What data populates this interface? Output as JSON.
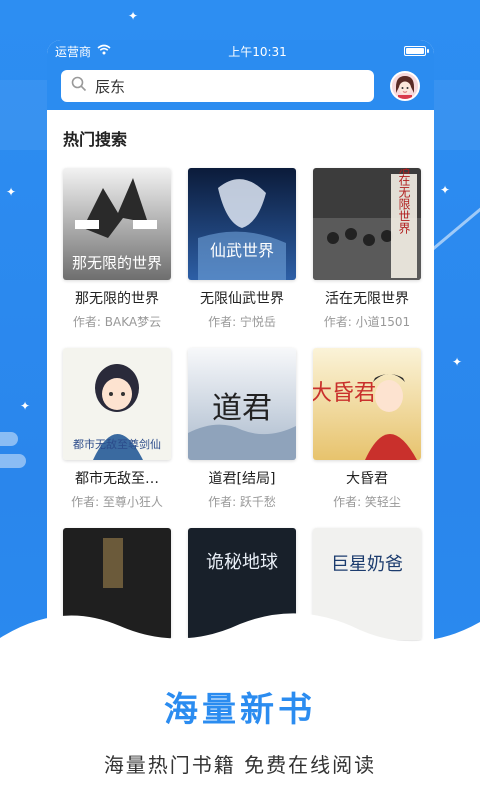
{
  "status_bar": {
    "carrier": "运营商",
    "time": "上午10:31",
    "battery_level": 1.0
  },
  "search": {
    "query": "辰东"
  },
  "section": {
    "title": "热门搜索"
  },
  "books": [
    {
      "title": "那无限的世界",
      "author": "作者: BAKA梦云",
      "cover_text": "那无限的世界"
    },
    {
      "title": "无限仙武世界",
      "author": "作者: 宁悦岳",
      "cover_text": "仙武世界"
    },
    {
      "title": "活在无限世界",
      "author": "作者: 小道1501",
      "cover_text": "活在无限世界"
    },
    {
      "title": "都市无敌至…",
      "author": "作者: 至尊小狂人",
      "cover_text": "都市无敌至尊剑仙"
    },
    {
      "title": "道君[结局]",
      "author": "作者: 跃千愁",
      "cover_text": "道君"
    },
    {
      "title": "大昏君",
      "author": "作者: 笑轻尘",
      "cover_text": "大昏君"
    },
    {
      "title": "",
      "author": "",
      "cover_text": ""
    },
    {
      "title": "",
      "author": "",
      "cover_text": "诡秘地球"
    },
    {
      "title": "",
      "author": "",
      "cover_text": "巨星奶爸"
    }
  ],
  "footer": {
    "slogan": "海量新书",
    "subslogan": "海量热门书籍  免费在线阅读"
  },
  "colors": {
    "brand": "#2b8cf0",
    "slogan": "#2b8cf0"
  },
  "icons": {
    "search": "search-icon",
    "wifi": "wifi-icon",
    "battery": "battery-icon",
    "avatar": "avatar"
  }
}
